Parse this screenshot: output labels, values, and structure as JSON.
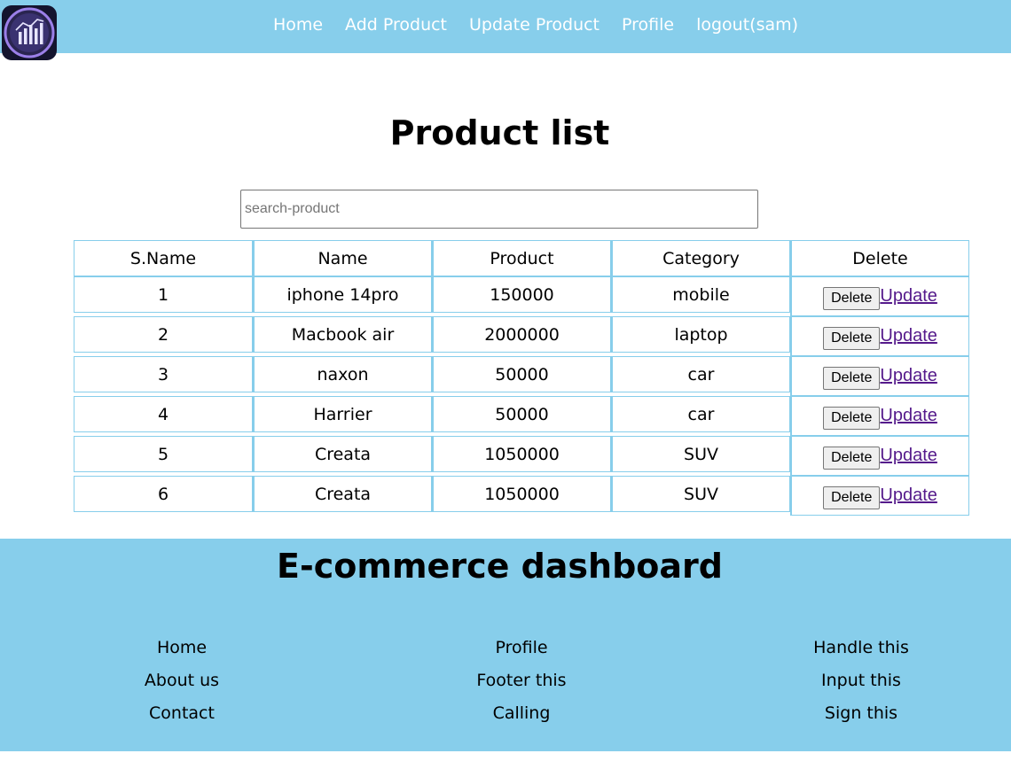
{
  "nav": {
    "links": [
      "Home",
      "Add Product",
      "Update Product",
      "Profile",
      "logout(sam)"
    ],
    "logo_icon": "analytics-chart-icon"
  },
  "main": {
    "title": "Product list",
    "search_placeholder": "search-product",
    "search_value": ""
  },
  "table": {
    "headers": [
      "S.Name",
      "Name",
      "Product",
      "Category",
      "Delete"
    ],
    "rows": [
      [
        "1",
        "iphone 14pro",
        "150000",
        "mobile"
      ],
      [
        "2",
        "Macbook air",
        "2000000",
        "laptop"
      ],
      [
        "3",
        "naxon",
        "50000",
        "car"
      ],
      [
        "4",
        "Harrier",
        "50000",
        "car"
      ],
      [
        "5",
        "Creata",
        "1050000",
        "SUV"
      ],
      [
        "6",
        "Creata",
        "1050000",
        "SUV"
      ]
    ],
    "delete_label": "Delete",
    "update_label": "Update"
  },
  "footer": {
    "title": "E-commerce dashboard",
    "columns": [
      [
        "Home",
        "About us",
        "Contact"
      ],
      [
        "Profile",
        "Footer this",
        "Calling"
      ],
      [
        "Handle this",
        "Input this",
        "Sign this"
      ]
    ]
  },
  "colors": {
    "nav_bg": "#87ceeb",
    "footer_bg": "#87ceeb",
    "table_border": "#87ceeb",
    "visited_link": "#551a8b"
  }
}
